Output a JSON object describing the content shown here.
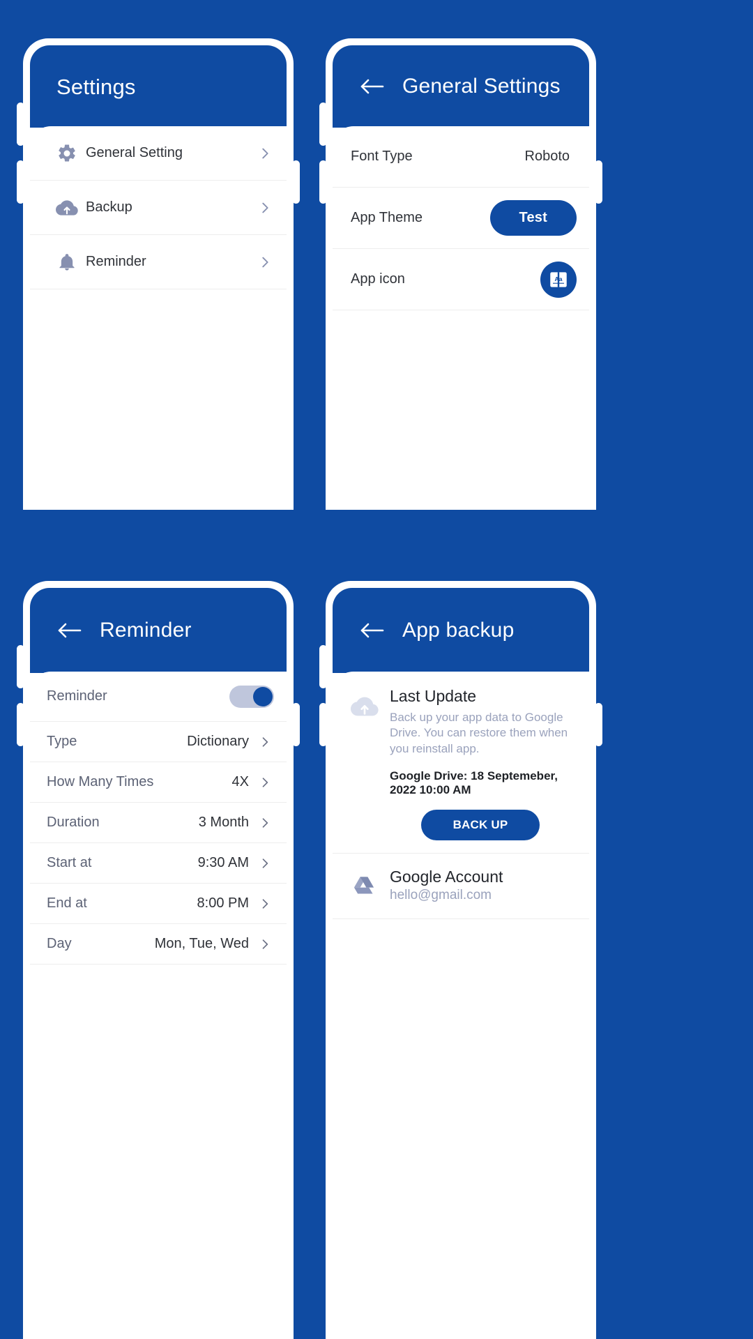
{
  "theme": {
    "background": "#0F4BA2",
    "accent": "#0F4BA2",
    "appbar": "#0F4BA2",
    "icon_muted": "#8790B0",
    "text_primary": "#2F3238",
    "text_muted": "#9AA2BC",
    "divider": "#EDEDED",
    "toggle_track": "#BFC6DC"
  },
  "screens": [
    {
      "id": "settings",
      "title": "Settings",
      "has_back": false,
      "rows": [
        {
          "icon": "gear-icon",
          "label": "General Setting",
          "value": "",
          "chevron": true
        },
        {
          "icon": "cloud-upload-icon",
          "label": "Backup",
          "value": "",
          "chevron": true
        },
        {
          "icon": "bell-icon",
          "label": "Reminder",
          "value": "",
          "chevron": true
        }
      ]
    },
    {
      "id": "general-settings",
      "title": "General Settings",
      "has_back": true,
      "rows": [
        {
          "label": "Font Type",
          "value": "Roboto",
          "control": "text"
        },
        {
          "label": "App Theme",
          "value": "Test",
          "control": "pill-button"
        },
        {
          "label": "App icon",
          "value": "Aa",
          "control": "icon-badge"
        }
      ]
    },
    {
      "id": "reminder",
      "title": "Reminder",
      "has_back": true,
      "rows": [
        {
          "label": "Reminder",
          "value": "",
          "control": "toggle",
          "toggle_on": true
        },
        {
          "label": "Type",
          "value": "Dictionary",
          "control": "chevron"
        },
        {
          "label": "How Many Times",
          "value": "4X",
          "control": "chevron"
        },
        {
          "label": "Duration",
          "value": "3 Month",
          "control": "chevron"
        },
        {
          "label": "Start at",
          "value": "9:30 AM",
          "control": "chevron"
        },
        {
          "label": "End at",
          "value": "8:00 PM",
          "control": "chevron"
        },
        {
          "label": "Day",
          "value": "Mon, Tue, Wed",
          "control": "chevron"
        }
      ]
    },
    {
      "id": "app-backup",
      "title": "App backup",
      "has_back": true,
      "backup": {
        "icon": "cloud-upload-icon",
        "title": "Last Update",
        "description": "Back up your app data to Google Drive. You can restore them when you reinstall app.",
        "meta": "Google Drive: 18 Septemeber, 2022 10:00 AM",
        "button_label": "BACK UP"
      },
      "account": {
        "icon": "google-drive-icon",
        "title": "Google Account",
        "email": "hello@gmail.com"
      }
    }
  ]
}
